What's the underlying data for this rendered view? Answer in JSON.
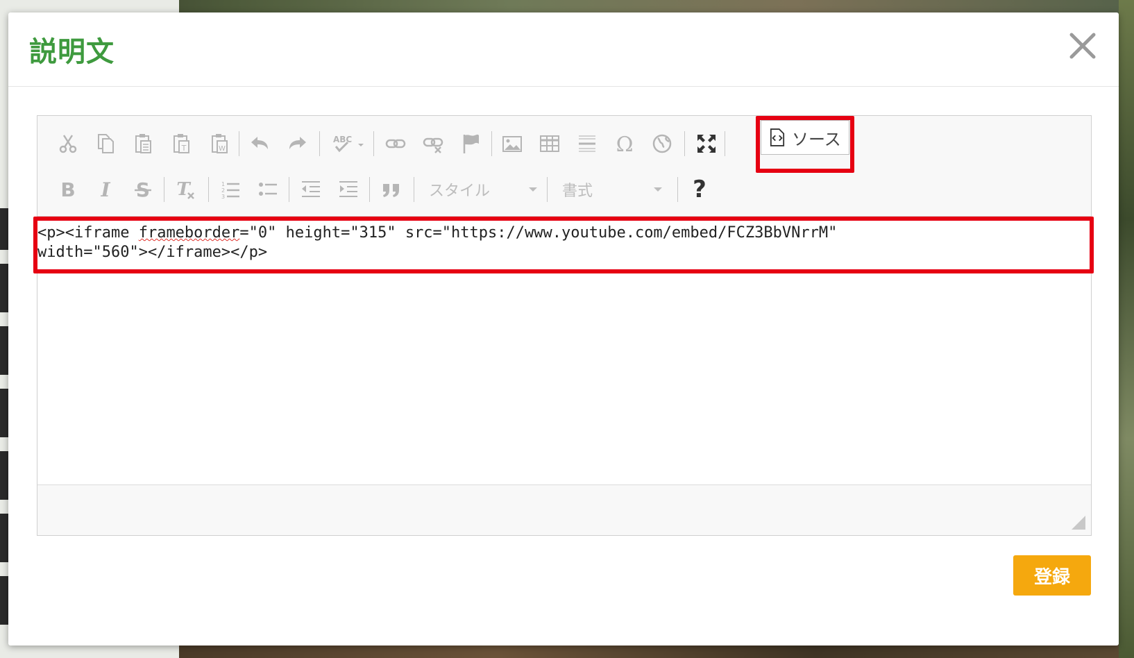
{
  "modal": {
    "title": "説明文",
    "close_icon": "close-icon",
    "submit_label": "登録"
  },
  "toolbar": {
    "row1_icons": [
      "cut-icon",
      "copy-icon",
      "paste-icon",
      "paste-text-icon",
      "paste-word-icon",
      "undo-icon",
      "redo-icon",
      "spellcheck-icon",
      "link-icon",
      "unlink-icon",
      "anchor-icon",
      "image-icon",
      "table-icon",
      "horizontal-rule-icon",
      "special-char-icon",
      "iframe-icon",
      "maximize-icon",
      "source-icon"
    ],
    "row2_icons": [
      "bold-icon",
      "italic-icon",
      "strike-icon",
      "remove-format-icon",
      "numbered-list-icon",
      "bulleted-list-icon",
      "outdent-icon",
      "indent-icon",
      "blockquote-icon",
      "help-icon"
    ],
    "source_label": "ソース",
    "style_combo": "スタイル",
    "format_combo": "書式",
    "help_glyph": "?"
  },
  "editor": {
    "source_line1_pre": "<p><iframe ",
    "source_line1_spell": "frameborder",
    "source_line1_post": "=\"0\" height=\"315\" src=\"https://www.youtube.com/embed/FCZ3BbVNrrM\"",
    "source_line2": "width=\"560\"></iframe></p>"
  },
  "colors": {
    "title_green": "#3e9a3e",
    "submit_orange": "#f5a80e",
    "highlight_red": "#e60012"
  }
}
